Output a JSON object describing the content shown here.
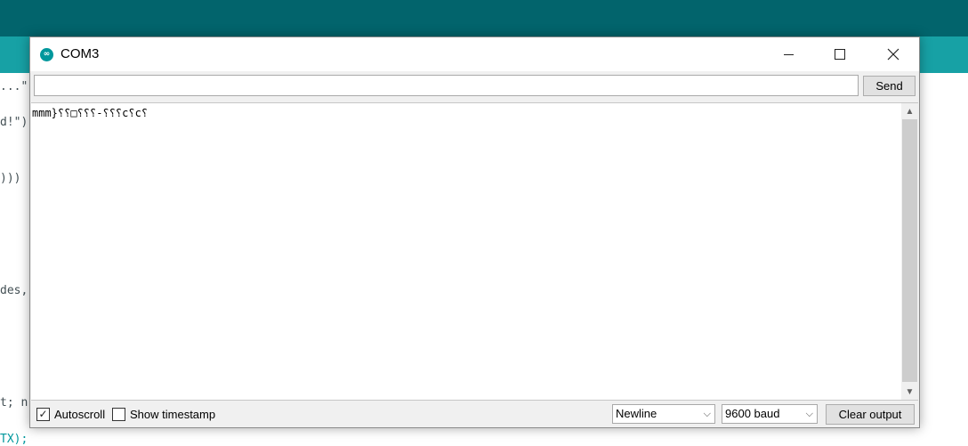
{
  "window": {
    "title": "COM3",
    "icon": "arduino-icon",
    "controls": [
      "minimize-icon",
      "maximize-icon",
      "close-icon"
    ]
  },
  "send_bar": {
    "input_value": "",
    "send_label": "Send"
  },
  "output": {
    "text": "mmm}⸮⸮□⸮⸮⸮-⸮⸮⸮c⸮c⸮"
  },
  "footer": {
    "autoscroll_label": "Autoscroll",
    "autoscroll_checked": true,
    "timestamp_label": "Show timestamp",
    "timestamp_checked": false,
    "line_ending": "Newline",
    "baud_rate": "9600 baud",
    "clear_label": "Clear output"
  },
  "background_editor": {
    "fragments": [
      "...\"",
      "d!\")",
      ")))",
      "des,",
      "t; n",
      "TX);"
    ]
  },
  "colors": {
    "ide_top": "#02646c",
    "ide_tabs": "#17a1a5",
    "accent": "#00979c"
  }
}
